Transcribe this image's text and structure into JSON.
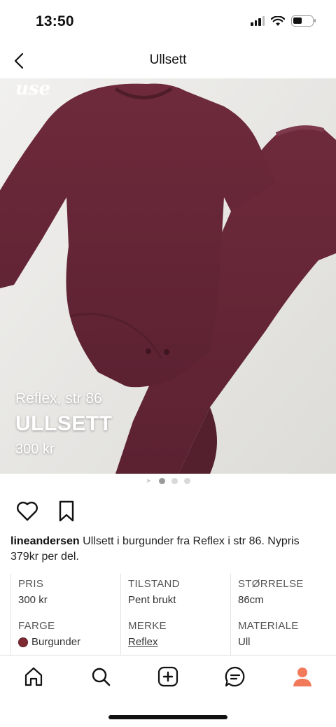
{
  "status_bar": {
    "time": "13:50",
    "battery_level": 0.45
  },
  "nav": {
    "title": "Ullsett",
    "back_icon": "chevron-left-icon"
  },
  "hero": {
    "watermark": "use",
    "subtitle": "Reflex, str 86",
    "title": "ULLSETT",
    "price": "300 kr",
    "image_count": 3,
    "active_image": 1
  },
  "actions": {
    "like_icon": "heart-icon",
    "save_icon": "bookmark-icon"
  },
  "post": {
    "username": "lineandersen",
    "text": " Ullsett i burgunder fra Reflex i str 86. Nypris 379kr per del."
  },
  "details": [
    {
      "label": "PRIS",
      "value": "300 kr"
    },
    {
      "label": "TILSTAND",
      "value": "Pent brukt"
    },
    {
      "label": "STØRRELSE",
      "value": "86cm"
    },
    {
      "label": "FARGE",
      "value": "Burgunder",
      "swatch_color": "#7f2a33"
    },
    {
      "label": "MERKE",
      "value": "Reflex",
      "link": true
    },
    {
      "label": "MATERIALE",
      "value": "Ull"
    }
  ],
  "tab_bar": {
    "tabs": [
      "home-icon",
      "search-icon",
      "add-icon",
      "messages-icon",
      "profile-icon"
    ],
    "active": "profile-icon",
    "active_color": "#f07a5a"
  }
}
